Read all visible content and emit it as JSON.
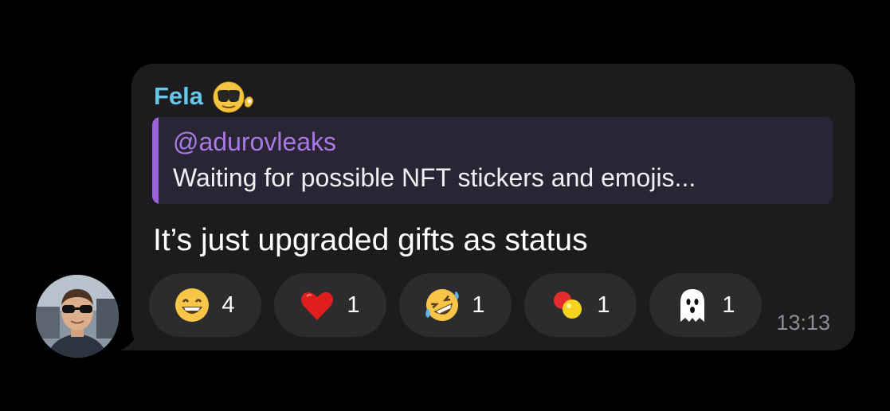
{
  "message": {
    "sender_name": "Fela",
    "sender_status_icon": "smiling-face-with-sunglasses-emoji",
    "reply": {
      "author": "@adurovleaks",
      "text": "Waiting for possible NFT stickers and emojis..."
    },
    "text": "It’s just upgraded gifts as status",
    "time": "13:13",
    "reactions": [
      {
        "icon": "grinning-face-emoji",
        "count": "4"
      },
      {
        "icon": "red-heart-emoji",
        "count": "1"
      },
      {
        "icon": "rolling-on-the-floor-laughing-emoji",
        "count": "1"
      },
      {
        "icon": "red-yellow-capsule-sticker",
        "count": "1"
      },
      {
        "icon": "ghost-emoji",
        "count": "1"
      }
    ]
  },
  "colors": {
    "background": "#000000",
    "bubble": "#1c1c1e",
    "sender_name": "#67c7e8",
    "reply_accent": "#9a64d8",
    "reply_background": "#2a2535",
    "reaction_background": "#2c2c2e",
    "timestamp": "#8e8e93"
  }
}
